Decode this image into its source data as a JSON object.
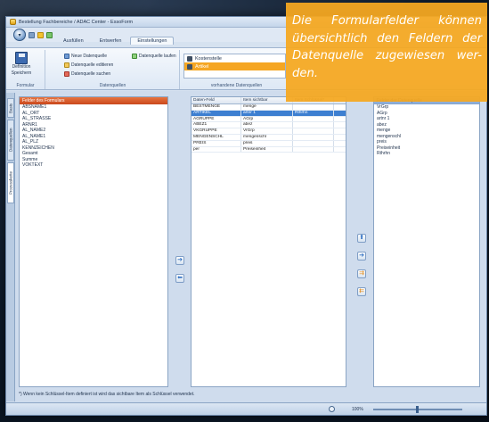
{
  "window": {
    "title": "Bestellung Fachbereiche / ADAC Center - EssoForm"
  },
  "ribbon": {
    "tabs": [
      "Ausfüllen",
      "Entwerfen",
      "Einstellungen"
    ],
    "groups": {
      "form": {
        "save_label_line1": "Definition",
        "save_label_line2": "Speichern",
        "label": "Formular"
      },
      "datasources": {
        "new": "Neue Datenquelle",
        "edit": "Datenquelle editieren",
        "search": "Datenquelle suchen",
        "linked": "Datenquelle laufen",
        "label": "Datenquellen"
      },
      "existing": {
        "items": [
          "Kostenstelle",
          "Artikel"
        ],
        "selected": "Artikel",
        "label": "vorhandene Datenquellen"
      }
    }
  },
  "side_tabs": [
    "Basis",
    "Datenquellen",
    "Prozesskette"
  ],
  "form_fields": {
    "title": "Felder des Formulars",
    "items": [
      "ABSNAME1",
      "AL_ORT",
      "AL_STRASSE",
      "ARNR1",
      "AL_NAME2",
      "AL_NAME1",
      "AL_PLZ",
      "KENNZEICHEN",
      "Gesamt",
      "Summe",
      "VOKTEXT"
    ]
  },
  "mapping": {
    "columns": [
      "Daten-Feld",
      "Item sichtbar",
      "Item Schlüssel*"
    ],
    "rows": [
      {
        "field": "BESTMENGE",
        "visible": "menge",
        "key": ""
      },
      {
        "field": "ARTIKEL",
        "visible": "artnr 1",
        "key": "Rthrhn",
        "selected": true
      },
      {
        "field": "AGRUPPE",
        "visible": "AGrp",
        "key": ""
      },
      {
        "field": "ABEZ1",
        "visible": "abez",
        "key": ""
      },
      {
        "field": "VKGRUPPE",
        "visible": "VrGrp",
        "key": ""
      },
      {
        "field": "MENGENSCHL",
        "visible": "mengenschl",
        "key": ""
      },
      {
        "field": "PREIS",
        "visible": "preis",
        "key": ""
      },
      {
        "field": "per",
        "visible": "Preiseinheit",
        "key": ""
      }
    ]
  },
  "datasource_fields": {
    "title": "Felder der Datenquelle",
    "items": [
      "VrGrp",
      "AGrp",
      "artnr 1",
      "abez",
      "menge",
      "mengenschl",
      "preis",
      "Preiseinheit",
      "Rthrhn"
    ]
  },
  "footnote": "*) Wenn kein Schlüssel-Item definiert ist wird das sichtbare Item als Schlüssel verwendet.",
  "statusbar": {
    "zoom": "100%"
  },
  "callout": {
    "text": "Die Formularfelder können übersichtlich den Feldern der Datenquelle zugewiesen wer-den."
  },
  "icons": {
    "move_right": "arrow-right-icon",
    "move_left": "arrow-left-icon",
    "move_up": "arrow-up-icon",
    "move_down": "arrow-down-icon"
  },
  "colors": {
    "accent_orange": "#F5A821",
    "header_orange": "#D9582A",
    "selection_blue": "#3D7FD1"
  }
}
